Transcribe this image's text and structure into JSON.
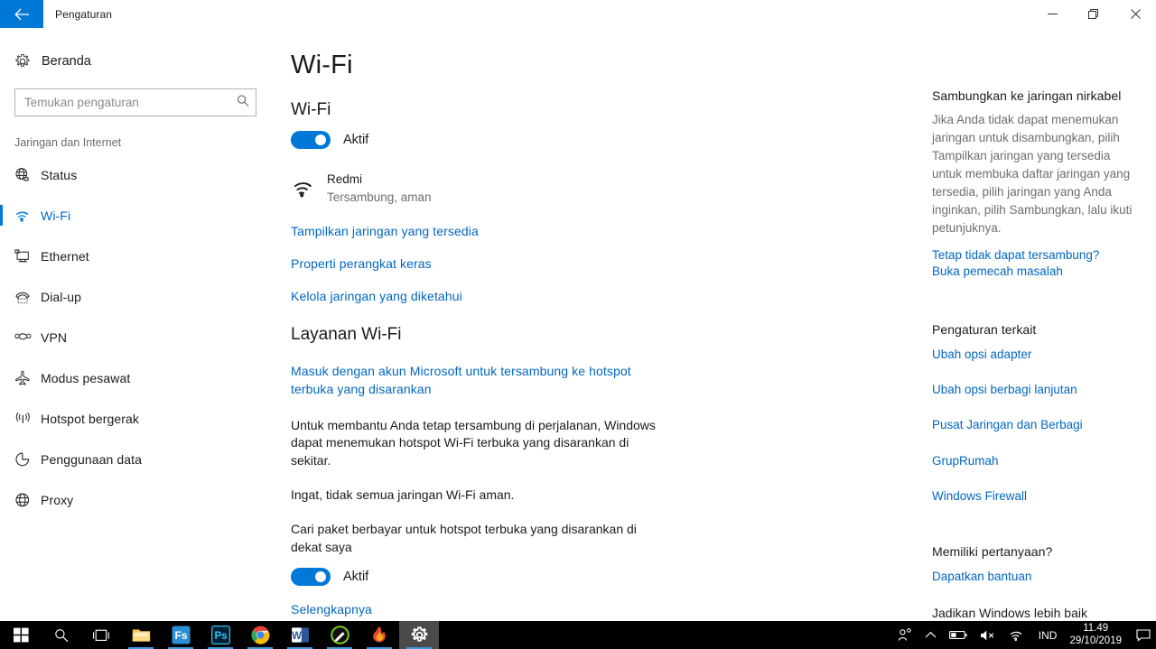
{
  "window": {
    "title": "Pengaturan",
    "back_label": "back-arrow",
    "minimize_label": "─",
    "restore_label": "❐",
    "close_label": "✕"
  },
  "sidebar": {
    "home_label": "Beranda",
    "search_placeholder": "Temukan pengaturan",
    "search_value": "",
    "group_title": "Jaringan dan Internet",
    "items": [
      {
        "label": "Status",
        "icon": "globe-status-icon",
        "selected": false
      },
      {
        "label": "Wi-Fi",
        "icon": "wifi-icon",
        "selected": true
      },
      {
        "label": "Ethernet",
        "icon": "ethernet-icon",
        "selected": false
      },
      {
        "label": "Dial-up",
        "icon": "dialup-phone-icon",
        "selected": false
      },
      {
        "label": "VPN",
        "icon": "vpn-icon",
        "selected": false
      },
      {
        "label": "Modus pesawat",
        "icon": "airplane-icon",
        "selected": false
      },
      {
        "label": "Hotspot bergerak",
        "icon": "hotspot-icon",
        "selected": false
      },
      {
        "label": "Penggunaan data",
        "icon": "data-usage-pie-icon",
        "selected": false
      },
      {
        "label": "Proxy",
        "icon": "globe-proxy-icon",
        "selected": false
      }
    ]
  },
  "main": {
    "page_title": "Wi-Fi",
    "wifi_section_title": "Wi-Fi",
    "wifi_toggle_state": "Aktif",
    "network": {
      "name": "Redmi",
      "status": "Tersambung, aman"
    },
    "links": {
      "show_available": "Tampilkan jaringan yang tersedia",
      "hardware_properties": "Properti perangkat keras",
      "manage_known": "Kelola jaringan yang diketahui",
      "learn_more": "Selengkapnya"
    },
    "services_title": "Layanan Wi-Fi",
    "ms_account_link": "Masuk dengan akun Microsoft untuk tersambung ke hotspot terbuka yang disarankan",
    "paragraph_1": "Untuk membantu Anda tetap tersambung di perjalanan, Windows dapat menemukan hotspot Wi-Fi terbuka yang disarankan di sekitar.",
    "paragraph_2": "Ingat, tidak semua jaringan Wi-Fi aman.",
    "paid_plans_label": "Cari paket berbayar untuk hotspot terbuka yang disarankan di dekat saya",
    "paid_plans_toggle_state": "Aktif"
  },
  "aside": {
    "connect_title": "Sambungkan ke jaringan nirkabel",
    "connect_body": "Jika Anda tidak dapat menemukan jaringan untuk disambungkan, pilih Tampilkan jaringan yang tersedia untuk membuka daftar jaringan yang tersedia, pilih jaringan yang Anda inginkan, pilih Sambungkan, lalu ikuti petunjuknya.",
    "troubleshoot_line1": "Tetap tidak dapat tersambung?",
    "troubleshoot_line2": "Buka pemecah masalah",
    "related_title": "Pengaturan terkait",
    "related_links": [
      "Ubah opsi adapter",
      "Ubah opsi berbagi lanjutan",
      "Pusat Jaringan dan Berbagi",
      "GrupRumah",
      "Windows Firewall"
    ],
    "questions_title": "Memiliki pertanyaan?",
    "questions_link": "Dapatkan bantuan",
    "improve_title": "Jadikan Windows lebih baik"
  },
  "taskbar": {
    "items": [
      {
        "name": "start-button",
        "label": "Start"
      },
      {
        "name": "search-button",
        "label": "Search"
      },
      {
        "name": "task-view-button",
        "label": "Task View"
      },
      {
        "name": "file-explorer-button",
        "label": "File Explorer"
      },
      {
        "name": "fs-app-button",
        "label": "Fs"
      },
      {
        "name": "photoshop-button",
        "label": "Ps"
      },
      {
        "name": "chrome-button",
        "label": "Google Chrome"
      },
      {
        "name": "word-button",
        "label": "W"
      },
      {
        "name": "pen-app-button",
        "label": "Pen"
      },
      {
        "name": "flame-app-button",
        "label": "Flame"
      },
      {
        "name": "settings-button",
        "label": "Pengaturan"
      }
    ],
    "tray": {
      "person_icon": "person-icon",
      "chevron_label": "∧",
      "battery_icon": "battery-icon",
      "volume_label": "muted-speaker-icon",
      "network_icon": "wifi-icon",
      "language": "IND",
      "time": "11.49",
      "date": "29/10/2019",
      "notification_icon": "notification-icon"
    }
  },
  "colors": {
    "accent": "#0078d7",
    "link": "#0067c0",
    "taskbar_bg": "#000000",
    "muted_text": "#6e6e6e"
  }
}
